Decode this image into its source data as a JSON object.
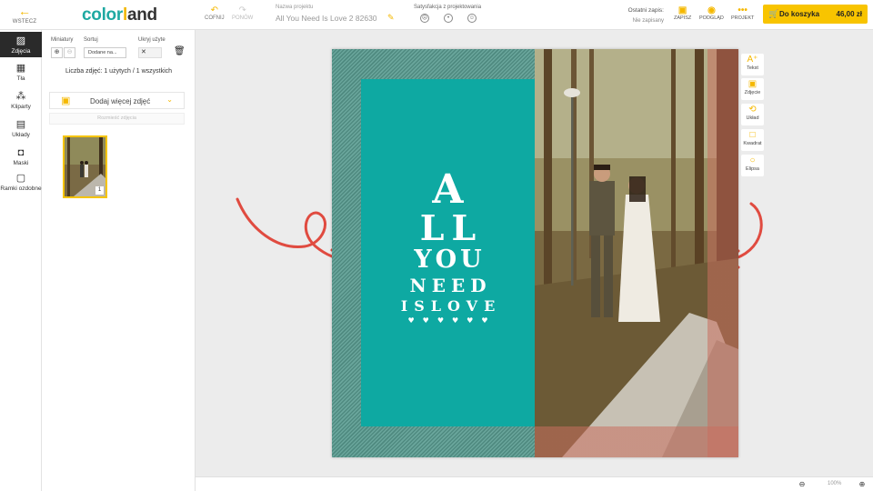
{
  "header": {
    "back_label": "WSTECZ",
    "logo": {
      "part1": "color",
      "part2": "l",
      "part3": "and"
    },
    "undo_label": "COFNIJ",
    "redo_label": "PONÓW",
    "project_name_label": "Nazwa projektu",
    "project_name_value": "All You Need Is Love 2 82630",
    "satisfaction_label": "Satysfakcja z projektowania",
    "last_save_label": "Ostatni zapis:",
    "last_save_value": "Nie zapisany",
    "save_label": "ZAPISZ",
    "preview_label": "PODGLĄD",
    "project_label": "PROJEKT",
    "cart_label": "Do koszyka",
    "cart_price": "46,00 zł"
  },
  "rail": {
    "items": [
      {
        "label": "Zdjęcia",
        "icon": "image-icon"
      },
      {
        "label": "Tła",
        "icon": "background-icon"
      },
      {
        "label": "Kliparty",
        "icon": "clipart-icon"
      },
      {
        "label": "Układy",
        "icon": "layout-icon"
      },
      {
        "label": "Maski",
        "icon": "mask-icon"
      },
      {
        "label": "Ramki ozdobne",
        "icon": "frame-icon"
      }
    ]
  },
  "panel": {
    "thumbs_label": "Miniatury",
    "sort_label": "Sortuj",
    "sort_value": "Dodane na...",
    "hide_used_label": "Ukryj użyte",
    "count_text": "Liczba zdjęć: 1 użytych / 1 wszystkich",
    "add_photos_label": "Dodaj więcej zdjęć",
    "sub_button_label": "Rozmieść zdjęcia",
    "thumb_badge": "1"
  },
  "poster": {
    "line1": "A",
    "line2": "LL",
    "line3": "YOU",
    "line4": "NEED",
    "line5": "ISLOVE",
    "hearts": "♥♥♥♥♥♥"
  },
  "right_tools": [
    {
      "label": "Tekst",
      "icon": "text-add-icon"
    },
    {
      "label": "Zdjęcie",
      "icon": "image-add-icon"
    },
    {
      "label": "Układ",
      "icon": "layout-swap-icon"
    },
    {
      "label": "Kwadrat",
      "icon": "square-icon"
    },
    {
      "label": "Elipsa",
      "icon": "ellipse-icon"
    }
  ],
  "bottom": {
    "zoom_value": "100%"
  },
  "colors": {
    "accent": "#f5b800",
    "teal": "#0ea9a2",
    "salmon": "#d48a7a"
  }
}
